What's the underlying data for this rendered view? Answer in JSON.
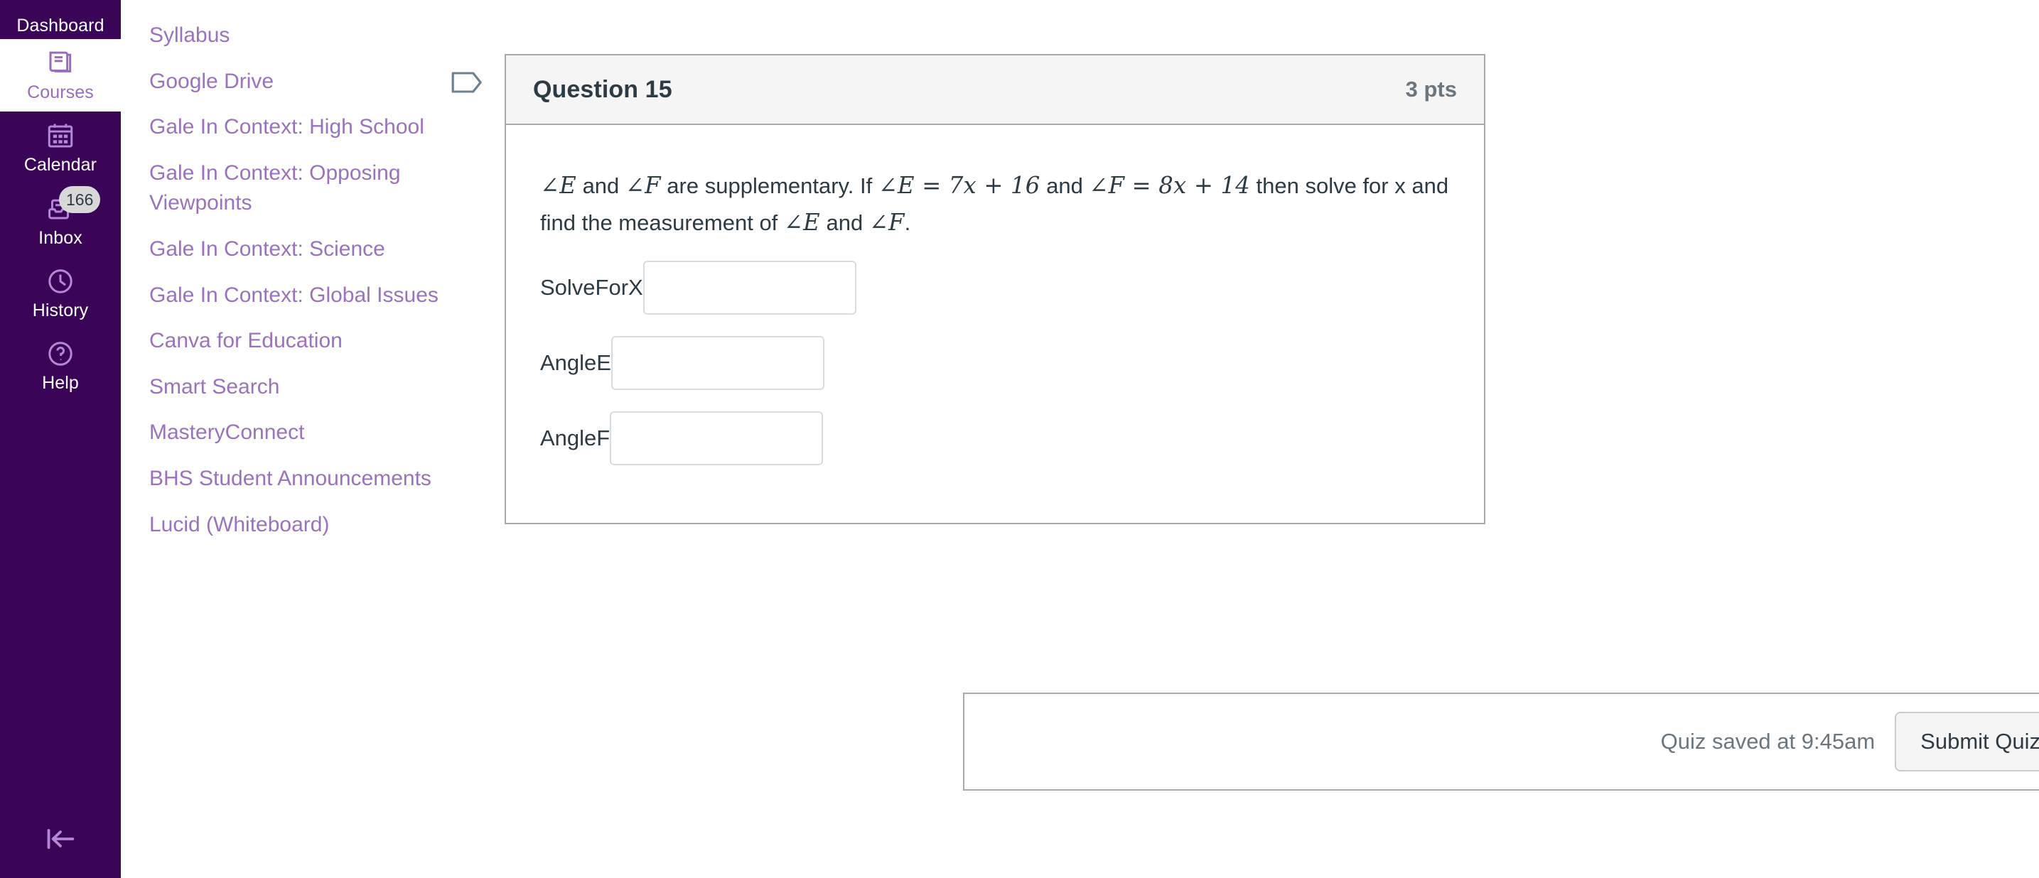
{
  "global_nav": {
    "items": [
      {
        "label": "Dashboard",
        "icon": "dashboard-icon",
        "active": false,
        "badge": null
      },
      {
        "label": "Courses",
        "icon": "courses-book-icon",
        "active": true,
        "badge": null
      },
      {
        "label": "Calendar",
        "icon": "calendar-icon",
        "active": false,
        "badge": null
      },
      {
        "label": "Inbox",
        "icon": "inbox-tray-icon",
        "active": false,
        "badge": "166"
      },
      {
        "label": "History",
        "icon": "history-clock-icon",
        "active": false,
        "badge": null
      },
      {
        "label": "Help",
        "icon": "help-question-icon",
        "active": false,
        "badge": null
      }
    ],
    "collapse_icon": "collapse-left-arrow-icon",
    "background_color": "#3A0557",
    "icon_color": "#B489D4",
    "active_text_color": "#9B6BBF"
  },
  "course_nav": {
    "link_color": "#9B72BD",
    "items": [
      {
        "label": "Syllabus"
      },
      {
        "label": "Google Drive"
      },
      {
        "label": "Gale In Context: High School"
      },
      {
        "label": "Gale In Context: Opposing Viewpoints"
      },
      {
        "label": "Gale In Context: Science"
      },
      {
        "label": "Gale In Context: Global Issues"
      },
      {
        "label": "Canva for Education"
      },
      {
        "label": "Smart Search"
      },
      {
        "label": "MasteryConnect"
      },
      {
        "label": "BHS Student Announcements"
      },
      {
        "label": "Lucid (Whiteboard)"
      }
    ]
  },
  "question": {
    "flag_icon": "question-flag-icon",
    "name": "Question 15",
    "points": "3 pts",
    "text_plain": "∠E and ∠F are supplementary. If ∠E = 7x + 16 and ∠F = 8x + 14 then solve for x and find the measurement of ∠E and ∠F.",
    "text_parts": {
      "m1": "∠E",
      "t1": " and ",
      "m2": "∠F",
      "t2": " are supplementary. If ",
      "m3": "∠E = 7x + 16",
      "t3": " and ",
      "m4": "∠F = 8x + 14",
      "t4": " then solve for x and find the measurement of ",
      "m5": "∠E",
      "t5": " and ",
      "m6": "∠F",
      "t6": "."
    },
    "answers": [
      {
        "label": "SolveForX",
        "value": "",
        "placeholder": ""
      },
      {
        "label": "AngleE",
        "value": "",
        "placeholder": ""
      },
      {
        "label": "AngleF",
        "value": "",
        "placeholder": ""
      }
    ]
  },
  "footer": {
    "saved_text": "Quiz saved at 9:45am",
    "submit_label": "Submit Quiz"
  }
}
